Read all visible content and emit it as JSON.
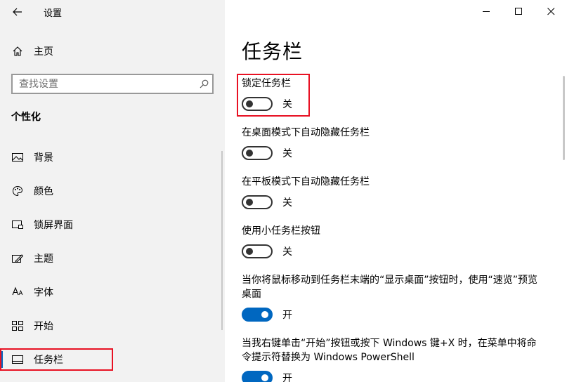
{
  "app": {
    "title": "设置",
    "back_icon": "back-arrow-icon"
  },
  "sidebar": {
    "home_label": "主页",
    "search_placeholder": "查找设置",
    "section_title": "个性化",
    "items": [
      {
        "label": "背景",
        "icon": "picture-icon",
        "active": false
      },
      {
        "label": "颜色",
        "icon": "palette-icon",
        "active": false
      },
      {
        "label": "锁屏界面",
        "icon": "lockscreen-icon",
        "active": false
      },
      {
        "label": "主题",
        "icon": "theme-icon",
        "active": false
      },
      {
        "label": "字体",
        "icon": "font-icon",
        "active": false
      },
      {
        "label": "开始",
        "icon": "start-icon",
        "active": false
      },
      {
        "label": "任务栏",
        "icon": "taskbar-icon",
        "active": true
      }
    ]
  },
  "window_controls": [
    "minimize",
    "maximize",
    "close"
  ],
  "main": {
    "title": "任务栏",
    "settings": [
      {
        "label": "锁定任务栏",
        "state": "关",
        "on": false
      },
      {
        "label": "在桌面模式下自动隐藏任务栏",
        "state": "关",
        "on": false
      },
      {
        "label": "在平板模式下自动隐藏任务栏",
        "state": "关",
        "on": false
      },
      {
        "label": "使用小任务栏按钮",
        "state": "关",
        "on": false
      },
      {
        "label": "当你将鼠标移动到任务栏末端的“显示桌面”按钮时，使用“速览”预览桌面",
        "state": "开",
        "on": true
      },
      {
        "label": "当我右键单击“开始”按钮或按下 Windows 键+X 时，在菜单中将命令提示符替换为 Windows PowerShell",
        "state": "开",
        "on": true
      }
    ]
  },
  "colors": {
    "accent": "#0067c0",
    "highlight": "#e81123"
  }
}
